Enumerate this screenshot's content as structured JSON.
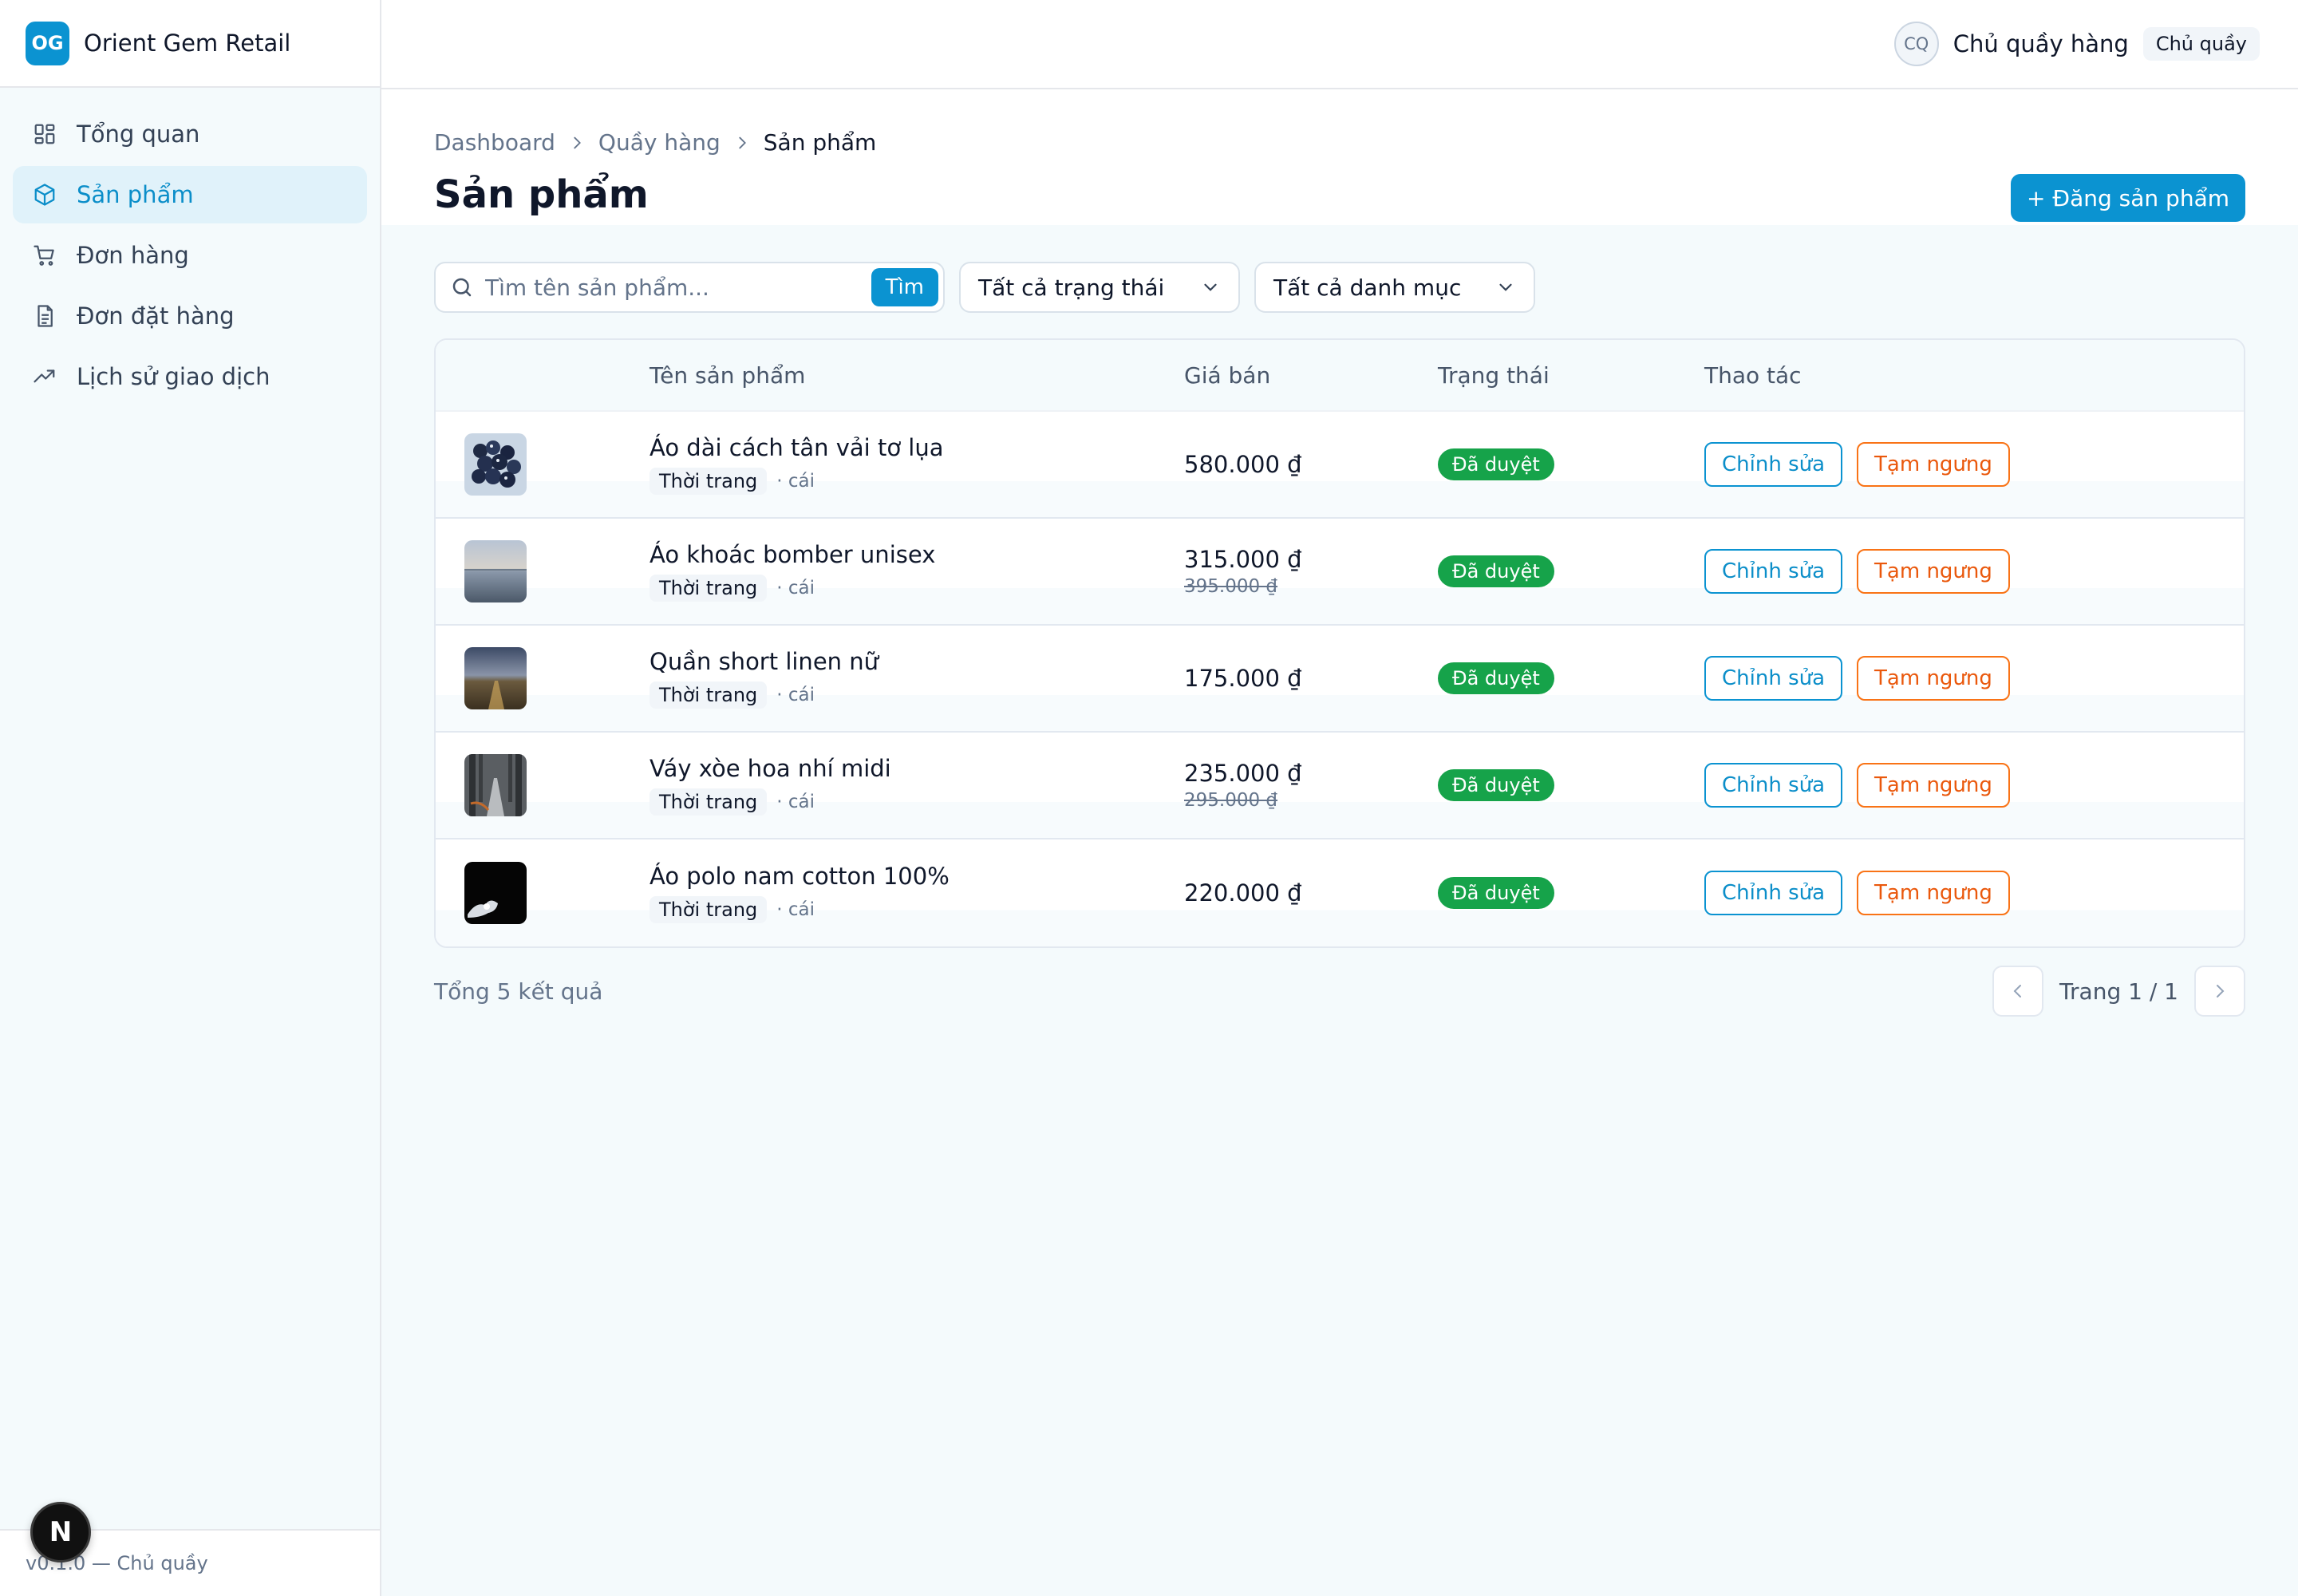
{
  "brand": {
    "logo": "OG",
    "name": "Orient Gem Retail"
  },
  "sidebar": {
    "items": [
      {
        "label": "Tổng quan",
        "icon": "dashboard-grid-icon",
        "active": false
      },
      {
        "label": "Sản phẩm",
        "icon": "package-icon",
        "active": true
      },
      {
        "label": "Đơn hàng",
        "icon": "cart-icon",
        "active": false
      },
      {
        "label": "Đơn đặt hàng",
        "icon": "document-icon",
        "active": false
      },
      {
        "label": "Lịch sử giao dịch",
        "icon": "trending-up-icon",
        "active": false
      }
    ],
    "footer": "v0.1.0 — Chủ quầy",
    "badge": "N"
  },
  "topbar": {
    "avatar": "CQ",
    "user_name": "Chủ quầy hàng",
    "role": "Chủ quầy"
  },
  "breadcrumb": [
    "Dashboard",
    "Quầy hàng",
    "Sản phẩm"
  ],
  "page": {
    "title": "Sản phẩm",
    "add_button": "+ Đăng sản phẩm"
  },
  "filters": {
    "search_placeholder": "Tìm tên sản phẩm...",
    "search_button": "Tìm",
    "status": "Tất cả trạng thái",
    "category": "Tất cả danh mục"
  },
  "table": {
    "columns": [
      "",
      "Tên sản phẩm",
      "Giá bán",
      "Trạng thái",
      "Thao tác"
    ],
    "rows": [
      {
        "name": "Áo dài cách tân vải tơ lụa",
        "category": "Thời trang",
        "unit": "· cái",
        "price": "580.000 ₫",
        "old_price": "",
        "status": "Đã duyệt",
        "edit": "Chỉnh sửa",
        "pause": "Tạm ngưng"
      },
      {
        "name": "Áo khoác bomber unisex",
        "category": "Thời trang",
        "unit": "· cái",
        "price": "315.000 ₫",
        "old_price": "395.000 ₫",
        "status": "Đã duyệt",
        "edit": "Chỉnh sửa",
        "pause": "Tạm ngưng"
      },
      {
        "name": "Quần short linen nữ",
        "category": "Thời trang",
        "unit": "· cái",
        "price": "175.000 ₫",
        "old_price": "",
        "status": "Đã duyệt",
        "edit": "Chỉnh sửa",
        "pause": "Tạm ngưng"
      },
      {
        "name": "Váy xòe hoa nhí midi",
        "category": "Thời trang",
        "unit": "· cái",
        "price": "235.000 ₫",
        "old_price": "295.000 ₫",
        "status": "Đã duyệt",
        "edit": "Chỉnh sửa",
        "pause": "Tạm ngưng"
      },
      {
        "name": "Áo polo nam cotton 100%",
        "category": "Thời trang",
        "unit": "· cái",
        "price": "220.000 ₫",
        "old_price": "",
        "status": "Đã duyệt",
        "edit": "Chỉnh sửa",
        "pause": "Tạm ngưng"
      }
    ]
  },
  "pagination": {
    "total": "Tổng 5 kết quả",
    "page_info": "Trang 1 / 1"
  },
  "colors": {
    "primary": "#0b93d1",
    "success": "#16a34a",
    "warning": "#ea580c"
  }
}
